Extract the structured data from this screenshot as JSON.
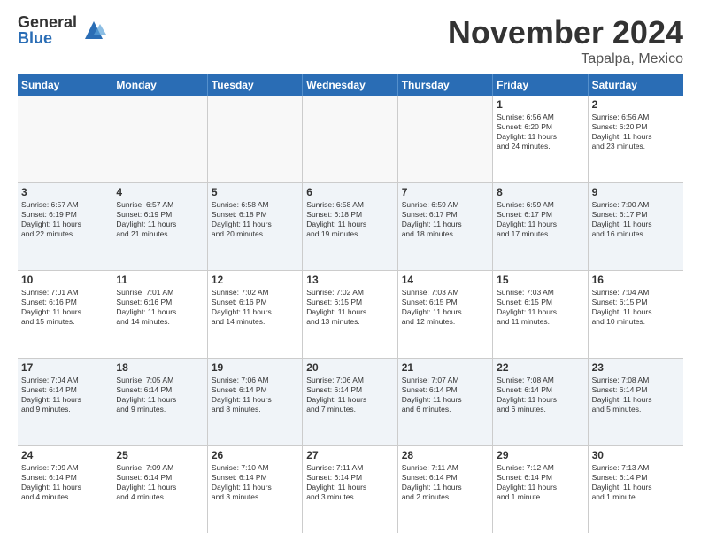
{
  "logo": {
    "general": "General",
    "blue": "Blue"
  },
  "header": {
    "month": "November 2024",
    "location": "Tapalpa, Mexico"
  },
  "weekdays": [
    "Sunday",
    "Monday",
    "Tuesday",
    "Wednesday",
    "Thursday",
    "Friday",
    "Saturday"
  ],
  "rows": [
    {
      "alt": false,
      "cells": [
        {
          "day": "",
          "empty": true,
          "info": ""
        },
        {
          "day": "",
          "empty": true,
          "info": ""
        },
        {
          "day": "",
          "empty": true,
          "info": ""
        },
        {
          "day": "",
          "empty": true,
          "info": ""
        },
        {
          "day": "",
          "empty": true,
          "info": ""
        },
        {
          "day": "1",
          "empty": false,
          "info": "Sunrise: 6:56 AM\nSunset: 6:20 PM\nDaylight: 11 hours\nand 24 minutes."
        },
        {
          "day": "2",
          "empty": false,
          "info": "Sunrise: 6:56 AM\nSunset: 6:20 PM\nDaylight: 11 hours\nand 23 minutes."
        }
      ]
    },
    {
      "alt": true,
      "cells": [
        {
          "day": "3",
          "empty": false,
          "info": "Sunrise: 6:57 AM\nSunset: 6:19 PM\nDaylight: 11 hours\nand 22 minutes."
        },
        {
          "day": "4",
          "empty": false,
          "info": "Sunrise: 6:57 AM\nSunset: 6:19 PM\nDaylight: 11 hours\nand 21 minutes."
        },
        {
          "day": "5",
          "empty": false,
          "info": "Sunrise: 6:58 AM\nSunset: 6:18 PM\nDaylight: 11 hours\nand 20 minutes."
        },
        {
          "day": "6",
          "empty": false,
          "info": "Sunrise: 6:58 AM\nSunset: 6:18 PM\nDaylight: 11 hours\nand 19 minutes."
        },
        {
          "day": "7",
          "empty": false,
          "info": "Sunrise: 6:59 AM\nSunset: 6:17 PM\nDaylight: 11 hours\nand 18 minutes."
        },
        {
          "day": "8",
          "empty": false,
          "info": "Sunrise: 6:59 AM\nSunset: 6:17 PM\nDaylight: 11 hours\nand 17 minutes."
        },
        {
          "day": "9",
          "empty": false,
          "info": "Sunrise: 7:00 AM\nSunset: 6:17 PM\nDaylight: 11 hours\nand 16 minutes."
        }
      ]
    },
    {
      "alt": false,
      "cells": [
        {
          "day": "10",
          "empty": false,
          "info": "Sunrise: 7:01 AM\nSunset: 6:16 PM\nDaylight: 11 hours\nand 15 minutes."
        },
        {
          "day": "11",
          "empty": false,
          "info": "Sunrise: 7:01 AM\nSunset: 6:16 PM\nDaylight: 11 hours\nand 14 minutes."
        },
        {
          "day": "12",
          "empty": false,
          "info": "Sunrise: 7:02 AM\nSunset: 6:16 PM\nDaylight: 11 hours\nand 14 minutes."
        },
        {
          "day": "13",
          "empty": false,
          "info": "Sunrise: 7:02 AM\nSunset: 6:15 PM\nDaylight: 11 hours\nand 13 minutes."
        },
        {
          "day": "14",
          "empty": false,
          "info": "Sunrise: 7:03 AM\nSunset: 6:15 PM\nDaylight: 11 hours\nand 12 minutes."
        },
        {
          "day": "15",
          "empty": false,
          "info": "Sunrise: 7:03 AM\nSunset: 6:15 PM\nDaylight: 11 hours\nand 11 minutes."
        },
        {
          "day": "16",
          "empty": false,
          "info": "Sunrise: 7:04 AM\nSunset: 6:15 PM\nDaylight: 11 hours\nand 10 minutes."
        }
      ]
    },
    {
      "alt": true,
      "cells": [
        {
          "day": "17",
          "empty": false,
          "info": "Sunrise: 7:04 AM\nSunset: 6:14 PM\nDaylight: 11 hours\nand 9 minutes."
        },
        {
          "day": "18",
          "empty": false,
          "info": "Sunrise: 7:05 AM\nSunset: 6:14 PM\nDaylight: 11 hours\nand 9 minutes."
        },
        {
          "day": "19",
          "empty": false,
          "info": "Sunrise: 7:06 AM\nSunset: 6:14 PM\nDaylight: 11 hours\nand 8 minutes."
        },
        {
          "day": "20",
          "empty": false,
          "info": "Sunrise: 7:06 AM\nSunset: 6:14 PM\nDaylight: 11 hours\nand 7 minutes."
        },
        {
          "day": "21",
          "empty": false,
          "info": "Sunrise: 7:07 AM\nSunset: 6:14 PM\nDaylight: 11 hours\nand 6 minutes."
        },
        {
          "day": "22",
          "empty": false,
          "info": "Sunrise: 7:08 AM\nSunset: 6:14 PM\nDaylight: 11 hours\nand 6 minutes."
        },
        {
          "day": "23",
          "empty": false,
          "info": "Sunrise: 7:08 AM\nSunset: 6:14 PM\nDaylight: 11 hours\nand 5 minutes."
        }
      ]
    },
    {
      "alt": false,
      "cells": [
        {
          "day": "24",
          "empty": false,
          "info": "Sunrise: 7:09 AM\nSunset: 6:14 PM\nDaylight: 11 hours\nand 4 minutes."
        },
        {
          "day": "25",
          "empty": false,
          "info": "Sunrise: 7:09 AM\nSunset: 6:14 PM\nDaylight: 11 hours\nand 4 minutes."
        },
        {
          "day": "26",
          "empty": false,
          "info": "Sunrise: 7:10 AM\nSunset: 6:14 PM\nDaylight: 11 hours\nand 3 minutes."
        },
        {
          "day": "27",
          "empty": false,
          "info": "Sunrise: 7:11 AM\nSunset: 6:14 PM\nDaylight: 11 hours\nand 3 minutes."
        },
        {
          "day": "28",
          "empty": false,
          "info": "Sunrise: 7:11 AM\nSunset: 6:14 PM\nDaylight: 11 hours\nand 2 minutes."
        },
        {
          "day": "29",
          "empty": false,
          "info": "Sunrise: 7:12 AM\nSunset: 6:14 PM\nDaylight: 11 hours\nand 1 minute."
        },
        {
          "day": "30",
          "empty": false,
          "info": "Sunrise: 7:13 AM\nSunset: 6:14 PM\nDaylight: 11 hours\nand 1 minute."
        }
      ]
    }
  ]
}
